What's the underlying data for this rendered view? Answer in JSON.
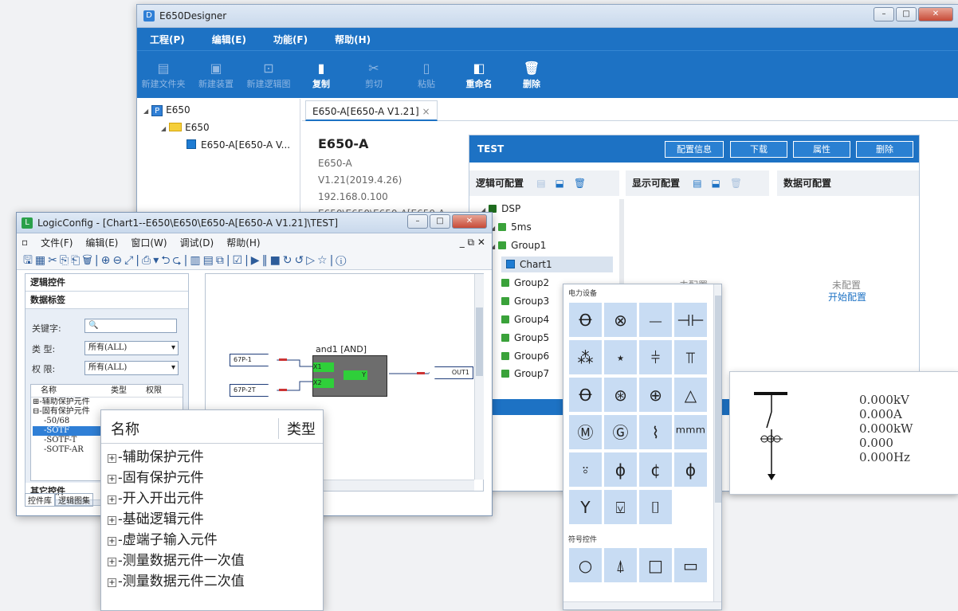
{
  "main": {
    "title": "E650Designer",
    "menu": [
      "工程(P)",
      "编辑(E)",
      "功能(F)",
      "帮助(H)"
    ],
    "toolbar": [
      {
        "label": "新建文件夹",
        "icon": "new-folder-icon",
        "enabled": false
      },
      {
        "label": "新建装置",
        "icon": "new-device-icon",
        "enabled": false
      },
      {
        "label": "新建逻辑图",
        "icon": "new-logic-icon",
        "enabled": false
      },
      {
        "label": "复制",
        "icon": "copy-icon",
        "enabled": true
      },
      {
        "label": "剪切",
        "icon": "cut-icon",
        "enabled": false
      },
      {
        "label": "粘贴",
        "icon": "paste-icon",
        "enabled": false
      },
      {
        "label": "重命名",
        "icon": "rename-icon",
        "enabled": true
      },
      {
        "label": "删除",
        "icon": "delete-icon",
        "enabled": true
      }
    ],
    "tree": [
      "E650",
      "E650",
      "E650-A[E650-A V..."
    ],
    "tab": "E650-A[E650-A V1.21]",
    "device": {
      "name": "E650-A",
      "lines": [
        "E650-A",
        "V1.21(2019.4.26)",
        "192.168.0.100",
        "E650\\E650\\E650-A[E650-A"
      ]
    },
    "panel": {
      "title": "TEST",
      "buttons": [
        "配置信息",
        "下载",
        "属性",
        "删除"
      ],
      "columns": [
        "逻辑可配置",
        "显示可配置",
        "数据可配置"
      ],
      "logic_tree": [
        "DSP",
        "5ms",
        "Group1",
        "Chart1",
        "Group2",
        "Group3",
        "Group4",
        "Group5",
        "Group6",
        "Group7"
      ],
      "unconfigured": "未配置",
      "start_config": "开始配置"
    }
  },
  "status": {
    "values": [
      "0.000kV",
      "0.000A",
      "0.000kW",
      "0.000",
      "0.000Hz"
    ]
  },
  "palette": {
    "section1": "电力设备",
    "section2": "符号控件",
    "symbols1": [
      "Ꝋ",
      "⊗",
      "⏤",
      "⊣⊢",
      "⁂",
      "⋆",
      "⫩",
      "⫪",
      "Ꝋ",
      "⊛",
      "⊕",
      "△",
      "Ⓜ",
      "Ⓖ",
      "⌇",
      "ᵐᵐᵐ",
      "⍤",
      "ϕ",
      "¢",
      "ϕ",
      "Y",
      "⍌",
      "⌷",
      ""
    ],
    "symbols2": [
      "○",
      "⍋",
      "□",
      "▭"
    ]
  },
  "logic": {
    "title": "LogicConfig - [Chart1--E650\\E650\\E650-A[E650-A V1.21]\\TEST]",
    "menu": [
      "文件(F)",
      "编辑(E)",
      "窗口(W)",
      "调试(D)",
      "帮助(H)"
    ],
    "sections": [
      "逻辑控件",
      "数据标签",
      "其它控件"
    ],
    "fields": {
      "keyword_label": "关键字:",
      "type_label": "类 型:",
      "type_value": "所有(ALL)",
      "perm_label": "权 限:",
      "perm_value": "所有(ALL)"
    },
    "list_headers": [
      "名称",
      "类型",
      "权限"
    ],
    "list": [
      "辅助保护元件",
      "固有保护元件",
      "50/68",
      "SOTF",
      "SOTF-T",
      "SOTF-AR"
    ],
    "bottom_tabs": [
      "控件库",
      "逻辑图集"
    ],
    "gate": {
      "label": "and1 [AND]",
      "in1": "X1",
      "in2": "X2",
      "out": "Y"
    },
    "inputs": [
      "67P-1",
      "67P-2T"
    ],
    "output": "OUT1"
  },
  "zoom": {
    "headers": [
      "名称",
      "类型"
    ],
    "items": [
      "辅助保护元件",
      "固有保护元件",
      "开入开出元件",
      "基础逻辑元件",
      "虚端子输入元件",
      "测量数据元件一次值",
      "测量数据元件二次值"
    ]
  }
}
